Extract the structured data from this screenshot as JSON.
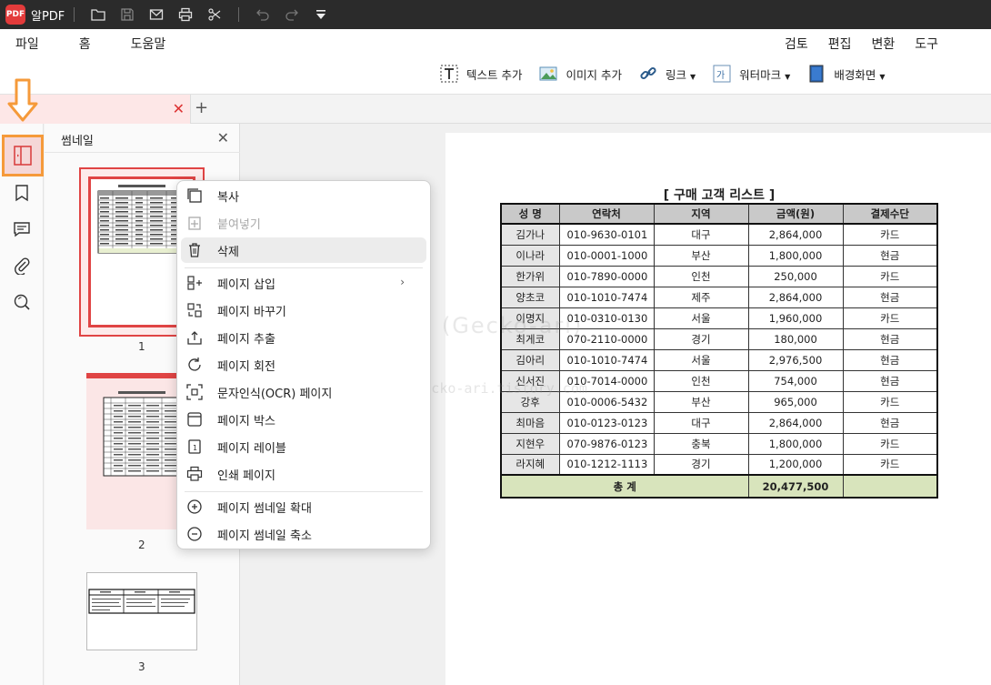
{
  "app": {
    "title": "알PDF",
    "logo_text": "PDF"
  },
  "menu": {
    "left": [
      "파일",
      "홈",
      "도움말"
    ],
    "right": [
      "검토",
      "편집",
      "변환",
      "도구"
    ],
    "active": "편집"
  },
  "ribbon": {
    "items": [
      {
        "label": "텍스트 추가",
        "icon": "text-box-icon"
      },
      {
        "label": "이미지 추가",
        "icon": "image-icon"
      },
      {
        "label": "링크",
        "icon": "link-icon"
      },
      {
        "label": "워터마크",
        "icon": "watermark-icon"
      },
      {
        "label": "배경화면",
        "icon": "background-icon"
      }
    ]
  },
  "thumbnails": {
    "title": "썸네일",
    "pages": [
      "1",
      "2",
      "3"
    ]
  },
  "document": {
    "title": "[ 구매 고객 리스트 ]",
    "watermark": "게코아리 (Gecko-ari)",
    "watermark_url": "https://gecko-ari.tistory.com",
    "headers": [
      "성 명",
      "연락처",
      "지역",
      "금액(원)",
      "결제수단"
    ],
    "rows": [
      [
        "김가나",
        "010-9630-0101",
        "대구",
        "2,864,000",
        "카드"
      ],
      [
        "이나라",
        "010-0001-1000",
        "부산",
        "1,800,000",
        "현금"
      ],
      [
        "한가위",
        "010-7890-0000",
        "인천",
        "250,000",
        "카드"
      ],
      [
        "양초코",
        "010-1010-7474",
        "제주",
        "2,864,000",
        "현금"
      ],
      [
        "이명지",
        "010-0310-0130",
        "서울",
        "1,960,000",
        "카드"
      ],
      [
        "최게코",
        "070-2110-0000",
        "경기",
        "180,000",
        "현금"
      ],
      [
        "김아리",
        "010-1010-7474",
        "서울",
        "2,976,500",
        "현금"
      ],
      [
        "신서진",
        "010-7014-0000",
        "인천",
        "754,000",
        "현금"
      ],
      [
        "강후",
        "010-0006-5432",
        "부산",
        "965,000",
        "카드"
      ],
      [
        "최마음",
        "010-0123-0123",
        "대구",
        "2,864,000",
        "현금"
      ],
      [
        "지현우",
        "070-9876-0123",
        "충북",
        "1,800,000",
        "카드"
      ],
      [
        "라지혜",
        "010-1212-1113",
        "경기",
        "1,200,000",
        "카드"
      ]
    ],
    "total_label": "총 계",
    "total_value": "20,477,500"
  },
  "context_menu": {
    "items": [
      {
        "label": "복사",
        "icon": "copy-icon"
      },
      {
        "label": "붙여넣기",
        "icon": "paste-icon",
        "disabled": true
      },
      {
        "label": "삭제",
        "icon": "trash-icon"
      },
      {
        "label": "페이지 삽입",
        "icon": "insert-page-icon",
        "submenu": true
      },
      {
        "label": "페이지 바꾸기",
        "icon": "replace-page-icon"
      },
      {
        "label": "페이지 추출",
        "icon": "extract-page-icon"
      },
      {
        "label": "페이지 회전",
        "icon": "rotate-icon"
      },
      {
        "label": "문자인식(OCR) 페이지",
        "icon": "ocr-icon"
      },
      {
        "label": "페이지 박스",
        "icon": "page-box-icon"
      },
      {
        "label": "페이지 레이블",
        "icon": "page-label-icon"
      },
      {
        "label": "인쇄 페이지",
        "icon": "print-icon"
      },
      {
        "label": "페이지 썸네일 확대",
        "icon": "zoom-in-icon"
      },
      {
        "label": "페이지 썸네일 축소",
        "icon": "zoom-out-icon"
      }
    ]
  },
  "colors": {
    "accent": "#e13a3a",
    "highlight": "#f59a3a",
    "total_row": "#d8e4bc"
  }
}
